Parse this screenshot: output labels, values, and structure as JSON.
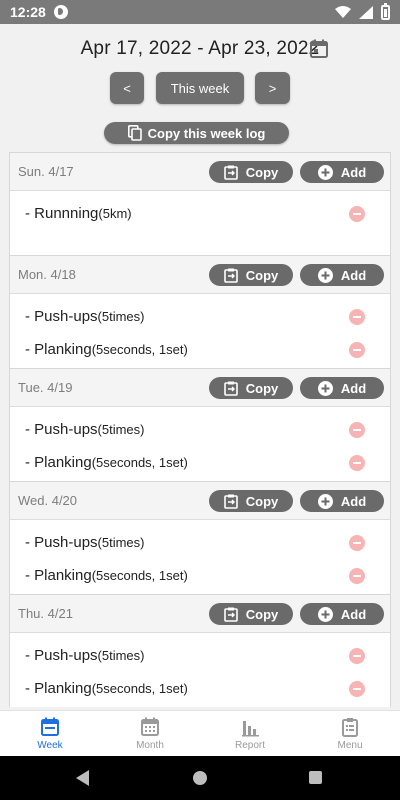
{
  "status_bar": {
    "time": "12:28",
    "icons": [
      "app-notification-icon",
      "wifi-icon",
      "signal-icon",
      "battery-icon"
    ]
  },
  "header": {
    "date_range": "Apr 17, 2022 - Apr 23, 2022",
    "calendar_icon": "calendar-icon",
    "prev_label": "<",
    "this_week_label": "This week",
    "next_label": ">",
    "copy_week_label": "Copy this week log"
  },
  "colors": {
    "button_bg": "#6f6f6f",
    "remove_icon": "#f7b4b4",
    "active_tab": "#1e6fe0",
    "inactive_tab": "#9a9a9a"
  },
  "day_buttons": {
    "copy_label": "Copy",
    "add_label": "Add"
  },
  "days": [
    {
      "label": "Sun. 4/17",
      "entries": [
        {
          "name": "- Runnning",
          "detail": "(5km)"
        }
      ]
    },
    {
      "label": "Mon. 4/18",
      "entries": [
        {
          "name": "- Push-ups",
          "detail": "(5times)"
        },
        {
          "name": "- Planking",
          "detail": "(5seconds, 1set)"
        }
      ]
    },
    {
      "label": "Tue. 4/19",
      "entries": [
        {
          "name": "- Push-ups",
          "detail": "(5times)"
        },
        {
          "name": "- Planking",
          "detail": "(5seconds, 1set)"
        }
      ]
    },
    {
      "label": "Wed. 4/20",
      "entries": [
        {
          "name": "- Push-ups",
          "detail": "(5times)"
        },
        {
          "name": "- Planking",
          "detail": "(5seconds, 1set)"
        }
      ]
    },
    {
      "label": "Thu. 4/21",
      "entries": [
        {
          "name": "- Push-ups",
          "detail": "(5times)"
        },
        {
          "name": "- Planking",
          "detail": "(5seconds, 1set)"
        }
      ]
    }
  ],
  "bottom_nav": {
    "tabs": [
      {
        "label": "Week",
        "icon": "calendar-week-icon",
        "active": true
      },
      {
        "label": "Month",
        "icon": "calendar-month-icon",
        "active": false
      },
      {
        "label": "Report",
        "icon": "bar-chart-icon",
        "active": false
      },
      {
        "label": "Menu",
        "icon": "clipboard-menu-icon",
        "active": false
      }
    ]
  }
}
